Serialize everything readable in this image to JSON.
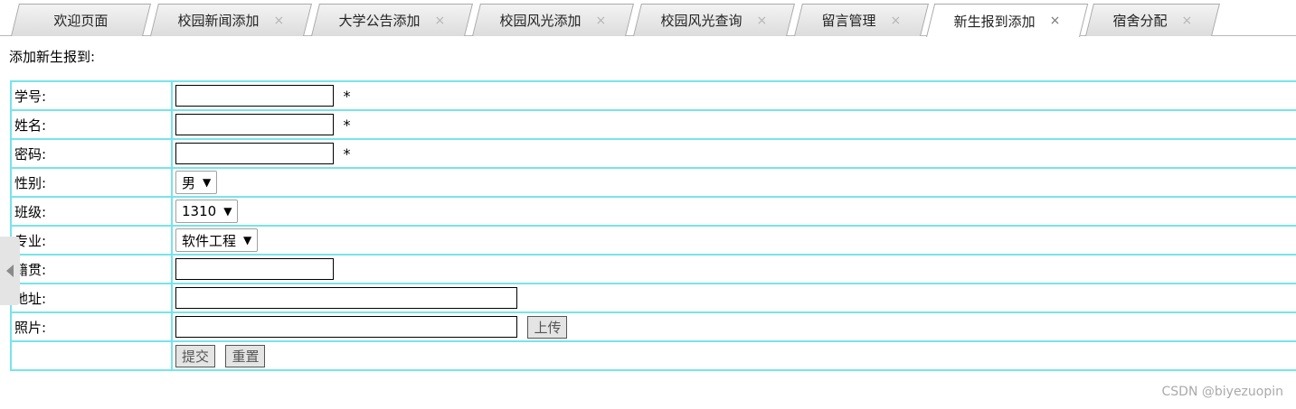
{
  "tabs": [
    {
      "label": "欢迎页面",
      "closable": false,
      "active": false
    },
    {
      "label": "校园新闻添加",
      "closable": true,
      "active": false
    },
    {
      "label": "大学公告添加",
      "closable": true,
      "active": false
    },
    {
      "label": "校园风光添加",
      "closable": true,
      "active": false
    },
    {
      "label": "校园风光查询",
      "closable": true,
      "active": false
    },
    {
      "label": "留言管理",
      "closable": true,
      "active": false
    },
    {
      "label": "新生报到添加",
      "closable": true,
      "active": true
    },
    {
      "label": "宿舍分配",
      "closable": true,
      "active": false
    }
  ],
  "close_glyph": "×",
  "page_heading": "添加新生报到:",
  "form": {
    "required_mark": "*",
    "student_id_label": "学号:",
    "name_label": "姓名:",
    "password_label": "密码:",
    "gender_label": "性别:",
    "gender_value": "男",
    "class_label": "班级:",
    "class_value": "1310",
    "major_label": "专业:",
    "major_value": "软件工程",
    "hometown_label": "籍贯:",
    "address_label": "地址:",
    "photo_label": "照片:",
    "upload_button": "上传",
    "submit_button": "提交",
    "reset_button": "重置"
  },
  "watermark": "CSDN @biyezuopin",
  "colors": {
    "table_border": "#77e4ea",
    "tab_active_bg": "#ffffff",
    "tab_inactive_bg": "#dcdcdc"
  }
}
